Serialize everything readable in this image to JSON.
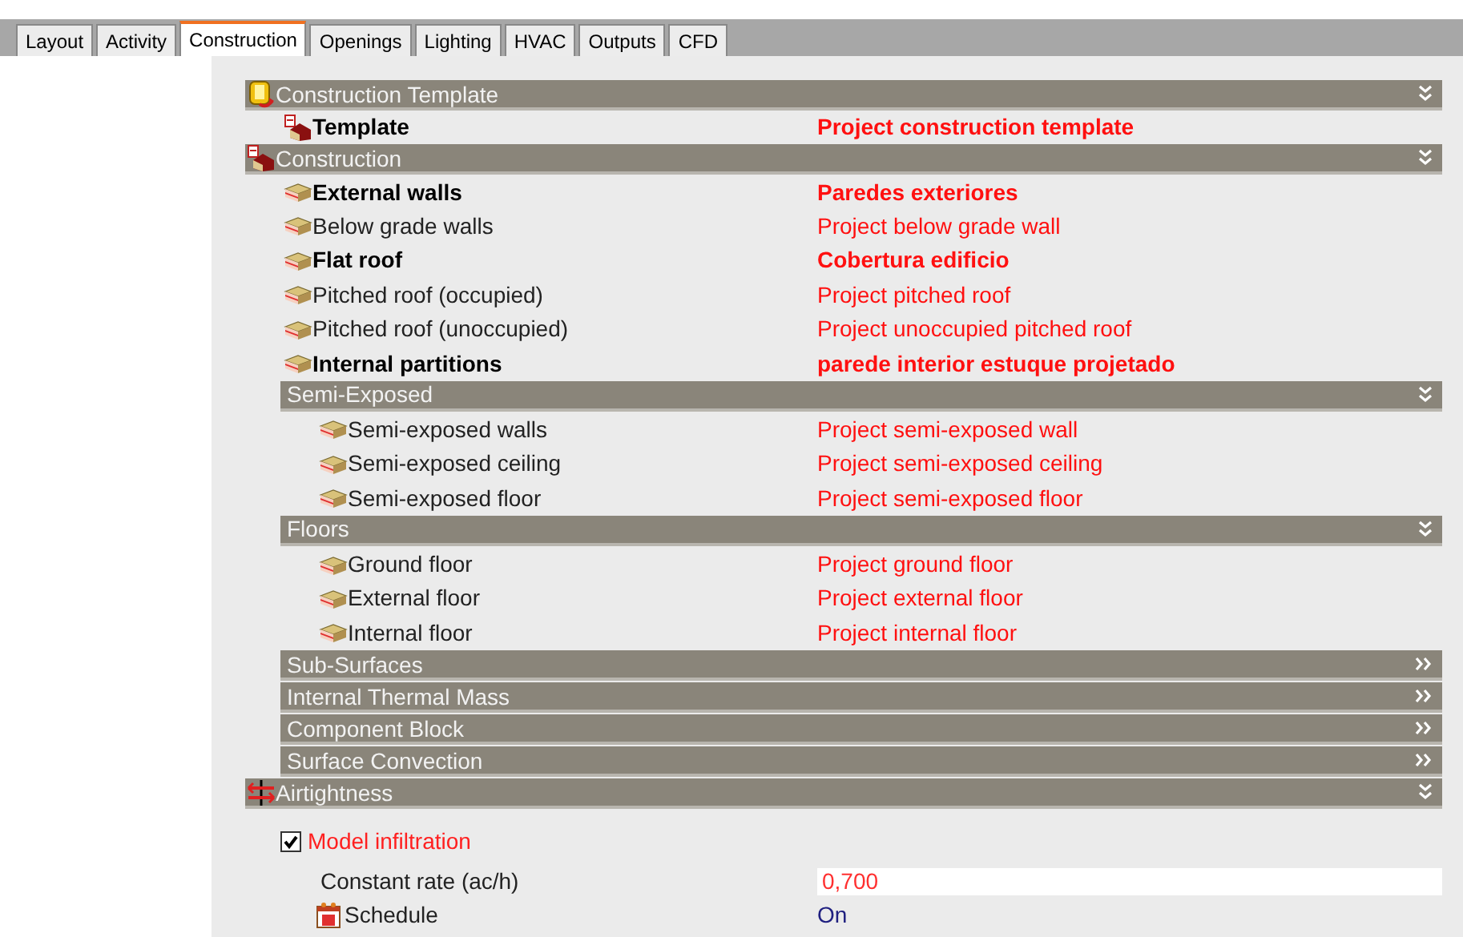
{
  "tabs": [
    {
      "label": "Layout",
      "selected": false
    },
    {
      "label": "Activity",
      "selected": false
    },
    {
      "label": "Construction",
      "selected": true
    },
    {
      "label": "Openings",
      "selected": false
    },
    {
      "label": "Lighting",
      "selected": false
    },
    {
      "label": "HVAC",
      "selected": false
    },
    {
      "label": "Outputs",
      "selected": false
    },
    {
      "label": "CFD",
      "selected": false
    }
  ],
  "sections": [
    {
      "title": "Construction Template",
      "expanded": true,
      "rows": [
        {
          "kind": "template",
          "label": "Template",
          "value": "Project construction template",
          "bold": true
        }
      ]
    },
    {
      "title": "Construction",
      "expanded": true,
      "rows": [
        {
          "kind": "layer",
          "label": "External walls",
          "value": "Paredes exteriores",
          "bold": true
        },
        {
          "kind": "layer",
          "label": "Below grade walls",
          "value": "Project below grade wall",
          "bold": false
        },
        {
          "kind": "layer",
          "label": "Flat roof",
          "value": "Cobertura edificio",
          "bold": true
        },
        {
          "kind": "layer",
          "label": "Pitched roof (occupied)",
          "value": "Project pitched roof",
          "bold": false
        },
        {
          "kind": "layer",
          "label": "Pitched roof (unoccupied)",
          "value": "Project unoccupied pitched roof",
          "bold": false
        },
        {
          "kind": "layer",
          "label": "Internal partitions",
          "value": "parede interior estuque projetado",
          "bold": true
        },
        {
          "kind": "group",
          "title": "Semi-Exposed",
          "expanded": true,
          "children": [
            {
              "kind": "layer",
              "label": "Semi-exposed walls",
              "value": "Project semi-exposed wall",
              "bold": false
            },
            {
              "kind": "layer",
              "label": "Semi-exposed ceiling",
              "value": "Project semi-exposed ceiling",
              "bold": false
            },
            {
              "kind": "layer",
              "label": "Semi-exposed floor",
              "value": "Project semi-exposed floor",
              "bold": false
            }
          ]
        },
        {
          "kind": "group",
          "title": "Floors",
          "expanded": true,
          "children": [
            {
              "kind": "layer",
              "label": "Ground floor",
              "value": "Project ground floor",
              "bold": false
            },
            {
              "kind": "layer",
              "label": "External floor",
              "value": "Project external floor",
              "bold": false
            },
            {
              "kind": "layer",
              "label": "Internal floor",
              "value": "Project internal floor",
              "bold": false
            }
          ]
        },
        {
          "kind": "group",
          "title": "Sub-Surfaces",
          "expanded": false,
          "children": []
        },
        {
          "kind": "group",
          "title": "Internal Thermal Mass",
          "expanded": false,
          "children": []
        },
        {
          "kind": "group",
          "title": "Component Block",
          "expanded": false,
          "children": []
        },
        {
          "kind": "group",
          "title": "Surface Convection",
          "expanded": false,
          "children": []
        }
      ]
    },
    {
      "title": "Airtightness",
      "expanded": true,
      "rows": [
        {
          "kind": "checkbox",
          "label": "Model infiltration",
          "checked": true
        },
        {
          "kind": "field",
          "label": "Constant rate (ac/h)",
          "value": "0,700"
        },
        {
          "kind": "schedule",
          "label": "Schedule",
          "value": "On"
        }
      ]
    }
  ]
}
